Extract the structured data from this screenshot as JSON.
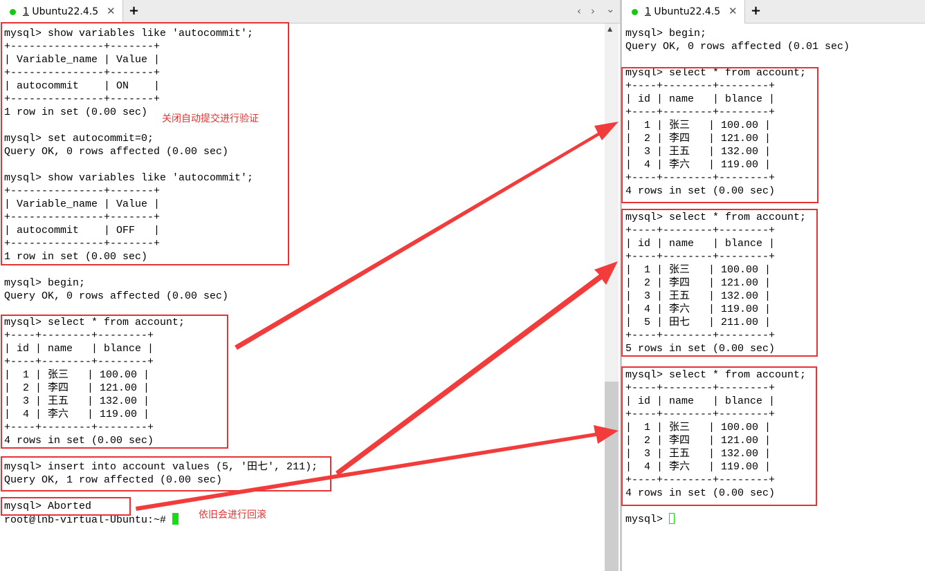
{
  "left_tab": {
    "index": "1",
    "title": " Ubuntu22.4.5",
    "close": "✕"
  },
  "right_tab": {
    "index": "1",
    "title": " Ubuntu22.4.5",
    "close": "✕"
  },
  "new_tab": "+",
  "nav": {
    "prev": "‹",
    "next": "›",
    "menu": "⌄"
  },
  "scrollbar_up": "▲",
  "left_terminal_text": "mysql> show variables like 'autocommit';\n+---------------+-------+\n| Variable_name | Value |\n+---------------+-------+\n| autocommit    | ON    |\n+---------------+-------+\n1 row in set (0.00 sec)\n\nmysql> set autocommit=0;\nQuery OK, 0 rows affected (0.00 sec)\n\nmysql> show variables like 'autocommit';\n+---------------+-------+\n| Variable_name | Value |\n+---------------+-------+\n| autocommit    | OFF   |\n+---------------+-------+\n1 row in set (0.00 sec)\n\nmysql> begin;\nQuery OK, 0 rows affected (0.00 sec)\n\nmysql> select * from account;\n+----+--------+--------+\n| id | name   | blance |\n+----+--------+--------+\n|  1 | 张三   | 100.00 |\n|  2 | 李四   | 121.00 |\n|  3 | 王五   | 132.00 |\n|  4 | 李六   | 119.00 |\n+----+--------+--------+\n4 rows in set (0.00 sec)\n\nmysql> insert into account values (5, '田七', 211);\nQuery OK, 1 row affected (0.00 sec)\n\nmysql> Aborted\nroot@lnb-virtual-Ubuntu:~# ",
  "right_terminal_text": "mysql> begin;\nQuery OK, 0 rows affected (0.01 sec)\n\nmysql> select * from account;\n+----+--------+--------+\n| id | name   | blance |\n+----+--------+--------+\n|  1 | 张三   | 100.00 |\n|  2 | 李四   | 121.00 |\n|  3 | 王五   | 132.00 |\n|  4 | 李六   | 119.00 |\n+----+--------+--------+\n4 rows in set (0.00 sec)\n\nmysql> select * from account;\n+----+--------+--------+\n| id | name   | blance |\n+----+--------+--------+\n|  1 | 张三   | 100.00 |\n|  2 | 李四   | 121.00 |\n|  3 | 王五   | 132.00 |\n|  4 | 李六   | 119.00 |\n|  5 | 田七   | 211.00 |\n+----+--------+--------+\n5 rows in set (0.00 sec)\n\nmysql> select * from account;\n+----+--------+--------+\n| id | name   | blance |\n+----+--------+--------+\n|  1 | 张三   | 100.00 |\n|  2 | 李四   | 121.00 |\n|  3 | 王五   | 132.00 |\n|  4 | 李六   | 119.00 |\n+----+--------+--------+\n4 rows in set (0.00 sec)\n\nmysql> ",
  "annotations": {
    "autocommit_note": "关闭自动提交进行验证",
    "rollback_note": "依旧会进行回滚"
  },
  "colors": {
    "annotation": "#e63232",
    "cursor": "#11e011",
    "tab_dot": "#14c814"
  }
}
